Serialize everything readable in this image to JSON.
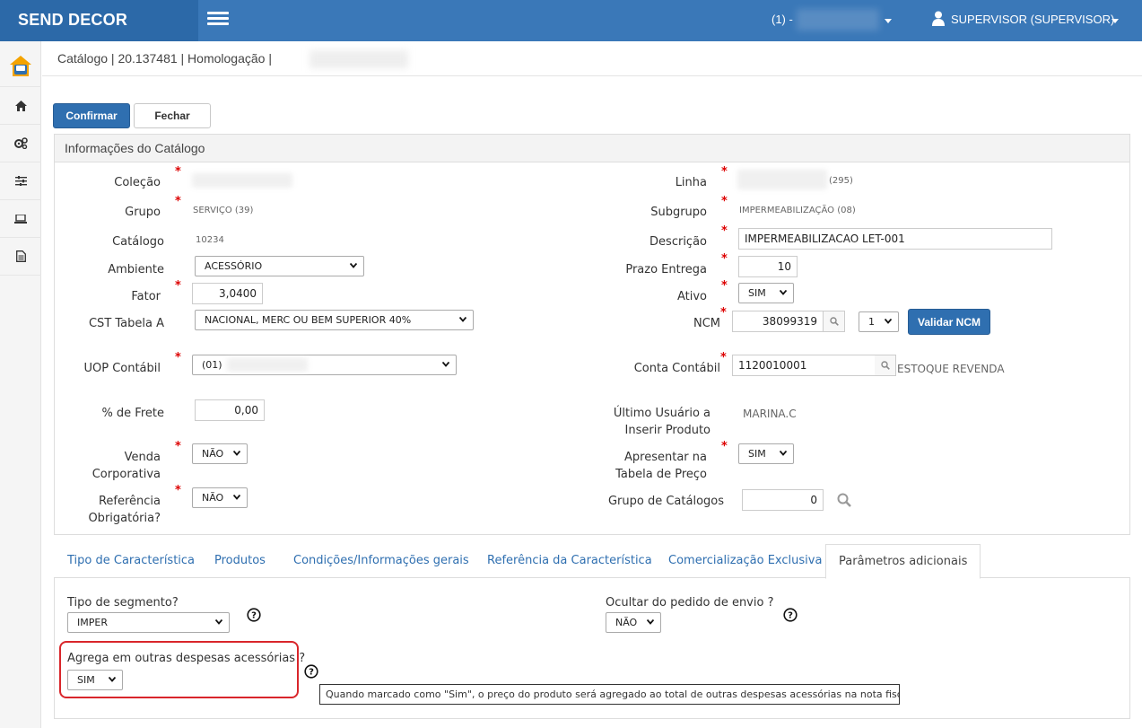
{
  "app": {
    "brand": "SEND DECOR"
  },
  "header": {
    "company_prefix": "(1) -",
    "user_label": "SUPERVISOR (SUPERVISOR)"
  },
  "breadcrumb": "Catálogo | 20.137481 | Homologação |",
  "toolbar": {
    "confirm_label": "Confirmar",
    "close_label": "Fechar"
  },
  "panel": {
    "title": "Informações do Catálogo",
    "labels": {
      "colecao": "Coleção",
      "grupo": "Grupo",
      "catalogo": "Catálogo",
      "ambiente": "Ambiente",
      "fator": "Fator",
      "cst": "CST Tabela A",
      "uop": "UOP Contábil",
      "frete": "% de Frete",
      "venda_corp": "Venda Corporativa",
      "ref_obrig_1": "Referência",
      "ref_obrig_2": "Obrigatória?",
      "linha": "Linha",
      "subgrupo": "Subgrupo",
      "descricao": "Descrição",
      "prazo": "Prazo Entrega",
      "ativo": "Ativo",
      "ncm": "NCM",
      "conta": "Conta Contábil",
      "ultimo_1": "Último Usuário a",
      "ultimo_2": "Inserir Produto",
      "apresentar_1": "Apresentar na",
      "apresentar_2": "Tabela de Preço",
      "grupo_cat": "Grupo de Catálogos"
    },
    "values": {
      "grupo": "SERVIÇO (39)",
      "catalogo": "10234",
      "ambiente": "ACESSÓRIO",
      "fator": "3,0400",
      "cst": "NACIONAL, MERC OU BEM SUPERIOR 40%",
      "uop": "(01)",
      "frete": "0,00",
      "venda_corp": "NÃO",
      "ref_obrig": "NÃO",
      "linha_suffix": "(295)",
      "subgrupo": "IMPERMEABILIZAÇÃO (08)",
      "descricao": "IMPERMEABILIZACAO LET-001",
      "prazo": "10",
      "ativo": "SIM",
      "ncm": "38099319",
      "ncm_seq": "1",
      "validar_ncm": "Validar NCM",
      "conta": "1120010001",
      "conta_desc": "ESTOQUE REVENDA",
      "ultimo_usuario": "MARINA.C",
      "apresentar": "SIM",
      "grupo_cat": "0"
    }
  },
  "tabs": [
    {
      "label": "Tipo de Característica"
    },
    {
      "label": "Produtos"
    },
    {
      "label": "Condições/Informações gerais"
    },
    {
      "label": "Referência da Característica"
    },
    {
      "label": "Comercialização Exclusiva"
    },
    {
      "label": "Parâmetros adicionais"
    }
  ],
  "params": {
    "tipo_segmento_label": "Tipo de segmento?",
    "tipo_segmento_value": "IMPER",
    "ocultar_label": "Ocultar do pedido de envio ?",
    "ocultar_value": "NÃO",
    "agrega_label": "Agrega em outras despesas acessórias ?",
    "agrega_value": "SIM",
    "tooltip": "Quando marcado como \"Sim\", o preço do produto será agregado ao total de outras despesas acessórias na nota fiscal."
  },
  "colors": {
    "header": "#3a78b8",
    "brand_bg": "#2c69a8",
    "primary": "#2f6fb0",
    "required": "#d00000",
    "highlight": "#d9262b"
  }
}
